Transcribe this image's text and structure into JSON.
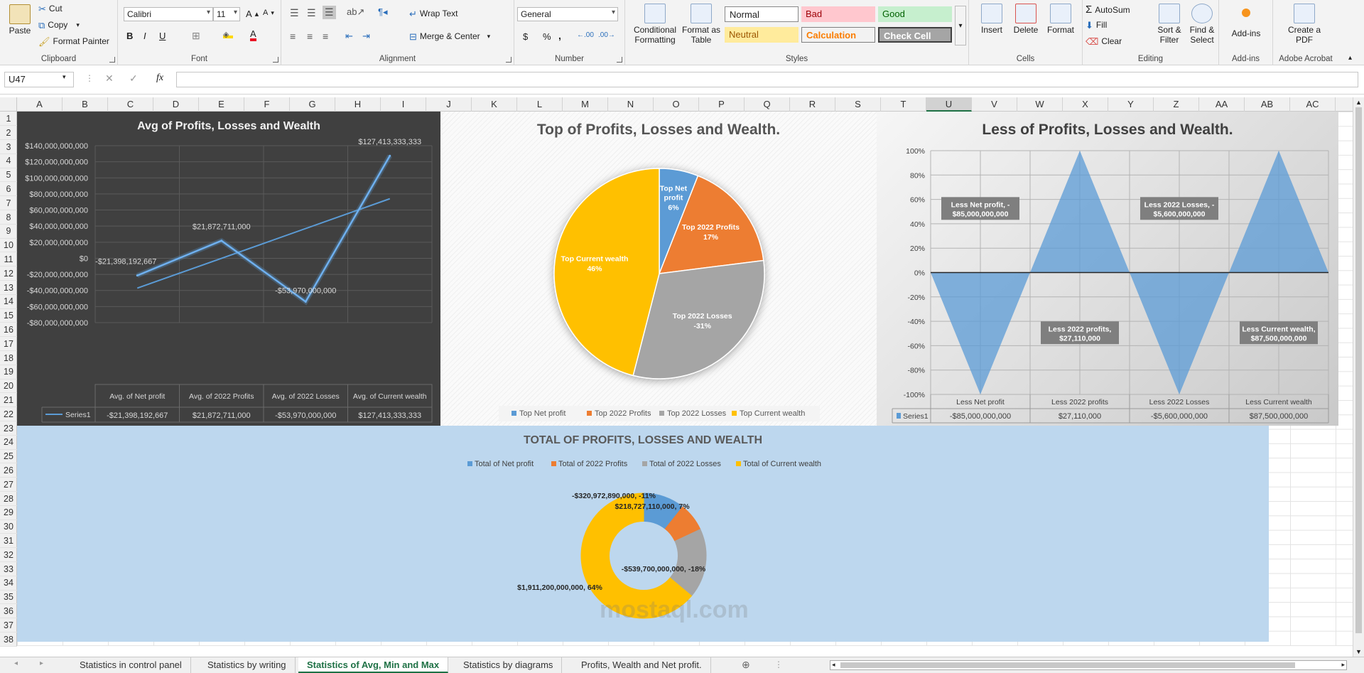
{
  "ribbon": {
    "clipboard": {
      "paste": "Paste",
      "cut": "Cut",
      "copy": "Copy",
      "format_painter": "Format Painter",
      "label": "Clipboard"
    },
    "font": {
      "name": "Calibri",
      "size": "11",
      "label": "Font",
      "bold": "B",
      "italic": "I",
      "underline": "U"
    },
    "alignment": {
      "wrap_text": "Wrap Text",
      "merge_center": "Merge & Center",
      "label": "Alignment"
    },
    "number": {
      "format": "General",
      "currency": "$",
      "percent": "%",
      "comma": ",",
      "label": "Number"
    },
    "styles": {
      "conditional": "Conditional Formatting",
      "format_as_table": "Format as Table",
      "normal": "Normal",
      "bad": "Bad",
      "good": "Good",
      "neutral": "Neutral",
      "calculation": "Calculation",
      "check_cell": "Check Cell",
      "label": "Styles"
    },
    "cells": {
      "insert": "Insert",
      "delete": "Delete",
      "format": "Format",
      "label": "Cells"
    },
    "editing": {
      "autosum": "AutoSum",
      "fill": "Fill",
      "clear": "Clear",
      "sort_filter": "Sort & Filter",
      "find_select": "Find & Select",
      "label": "Editing"
    },
    "addins": {
      "addins": "Add-ins",
      "label": "Add-ins"
    },
    "acrobat": {
      "create_pdf": "Create a PDF",
      "label": "Adobe Acrobat"
    }
  },
  "formula_bar": {
    "name_box": "U47",
    "fx": "fx",
    "value": ""
  },
  "columns": [
    "A",
    "B",
    "C",
    "D",
    "E",
    "F",
    "G",
    "H",
    "I",
    "J",
    "K",
    "L",
    "M",
    "N",
    "O",
    "P",
    "Q",
    "R",
    "S",
    "T",
    "U",
    "V",
    "W",
    "X",
    "Y",
    "Z",
    "AA",
    "AB",
    "AC"
  ],
  "rows": [
    "1",
    "2",
    "3",
    "4",
    "5",
    "6",
    "7",
    "8",
    "9",
    "10",
    "11",
    "12",
    "13",
    "14",
    "15",
    "16",
    "17",
    "18",
    "19",
    "20",
    "21",
    "22",
    "23",
    "24",
    "25",
    "26",
    "27",
    "28",
    "29",
    "30",
    "31",
    "32",
    "33",
    "34",
    "35",
    "36",
    "37",
    "38"
  ],
  "sheet_tabs": [
    "Statistics in control panel",
    "Statistics by writing",
    "Statistics of Avg, Min and Max",
    "Statistics by diagrams",
    "Profits, Wealth and Net profit."
  ],
  "active_tab": "Statistics of Avg, Min and Max",
  "watermark": "mostaql.com",
  "colors": {
    "blue": "#5b9bd5",
    "orange": "#ed7d31",
    "gray": "#a5a5a5",
    "gold": "#ffc000",
    "excel_green": "#1e7145"
  },
  "chart_data": [
    {
      "type": "line",
      "title": "Avg of Profits, Losses and Wealth",
      "categories": [
        "Avg. of Net profit",
        "Avg. of 2022 Profits",
        "Avg. of 2022 Losses",
        "Avg. of Current wealth"
      ],
      "series": [
        {
          "name": "Series1",
          "values": [
            -21398192667,
            21872711000,
            -53970000000,
            127413333333
          ]
        }
      ],
      "data_labels": [
        "-$21,398,192,667",
        "$21,872,711,000",
        "-$53,970,000,000",
        "$127,413,333,333"
      ],
      "y_ticks": [
        "$140,000,000,000",
        "$120,000,000,000",
        "$100,000,000,000",
        "$80,000,000,000",
        "$60,000,000,000",
        "$40,000,000,000",
        "$20,000,000,000",
        "$0",
        "-$20,000,000,000",
        "-$40,000,000,000",
        "-$60,000,000,000",
        "-$80,000,000,000"
      ],
      "ylim": [
        -80000000000,
        140000000000
      ],
      "trendline": true,
      "data_table": true
    },
    {
      "type": "pie",
      "title": "Top of Profits, Losses and Wealth.",
      "categories": [
        "Top Net profit",
        "Top 2022 Profits",
        "Top 2022 Losses",
        "Top Current wealth"
      ],
      "values": [
        6,
        17,
        -31,
        46
      ],
      "data_labels": [
        "6%",
        "17%",
        "-31%",
        "46%"
      ],
      "legend": "bottom"
    },
    {
      "type": "area",
      "title": "Less of Profits, Losses and Wealth.",
      "categories": [
        "Less Net profit",
        "Less 2022 profits",
        "Less 2022 Losses",
        "Less Current wealth"
      ],
      "series": [
        {
          "name": "Series1",
          "values": [
            -100,
            100,
            -100,
            100
          ]
        }
      ],
      "table_values": [
        "-$85,000,000,000",
        "$27,110,000",
        "-$5,600,000,000",
        "$87,500,000,000"
      ],
      "data_labels": [
        "Less Net profit, -\n$85,000,000,000",
        "Less 2022 profits,\n$27,110,000",
        "Less 2022 Losses, -\n$5,600,000,000",
        "Less Current wealth,\n$87,500,000,000"
      ],
      "y_ticks": [
        "100%",
        "80%",
        "60%",
        "40%",
        "20%",
        "0%",
        "-20%",
        "-40%",
        "-60%",
        "-80%",
        "-100%"
      ],
      "ylim": [
        -100,
        100
      ]
    },
    {
      "type": "pie",
      "subtype": "doughnut",
      "title": "TOTAL OF PROFITS, LOSSES AND WEALTH",
      "categories": [
        "Total of Net profit",
        "Total of 2022 Profits",
        "Total of 2022 Losses",
        "Total of Current wealth"
      ],
      "values": [
        -320972890000,
        218727110000,
        -539700000000,
        1911200000000
      ],
      "percents": [
        -11,
        7,
        -18,
        64
      ],
      "data_labels": [
        "-$320,972,890,000, -11%",
        "$218,727,110,000, 7%",
        "-$539,700,000,000, -18%",
        "$1,911,200,000,000, 64%"
      ],
      "legend": "top"
    }
  ]
}
